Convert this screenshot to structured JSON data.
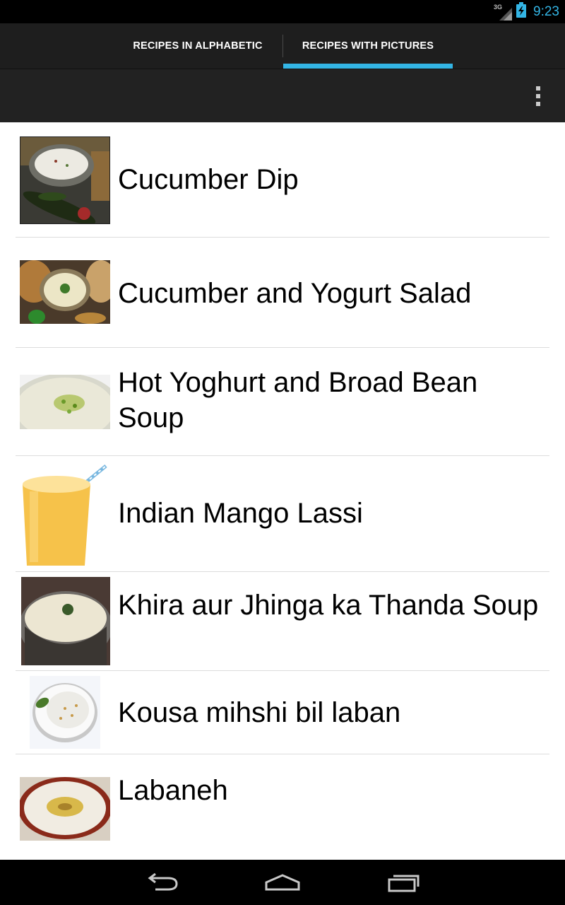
{
  "status_bar": {
    "network_label": "3G",
    "time": "9:23",
    "icons": [
      "signal-icon",
      "battery-charging-icon"
    ]
  },
  "tabs": [
    {
      "label": "RECIPES IN ALPHABETIC",
      "selected": false
    },
    {
      "label": "RECIPES WITH PICTURES",
      "selected": true
    }
  ],
  "accent_color": "#33b5e5",
  "recipes": [
    {
      "name": "Cucumber Dip"
    },
    {
      "name": "Cucumber and Yogurt Salad"
    },
    {
      "name": "Hot Yoghurt and Broad Bean Soup"
    },
    {
      "name": "Indian Mango Lassi"
    },
    {
      "name": "Khira aur Jhinga ka Thanda Soup"
    },
    {
      "name": "Kousa mihshi bil laban"
    },
    {
      "name": "Labaneh"
    }
  ],
  "nav_bar": {
    "icons": [
      "back-icon",
      "home-icon",
      "recent-apps-icon"
    ]
  }
}
